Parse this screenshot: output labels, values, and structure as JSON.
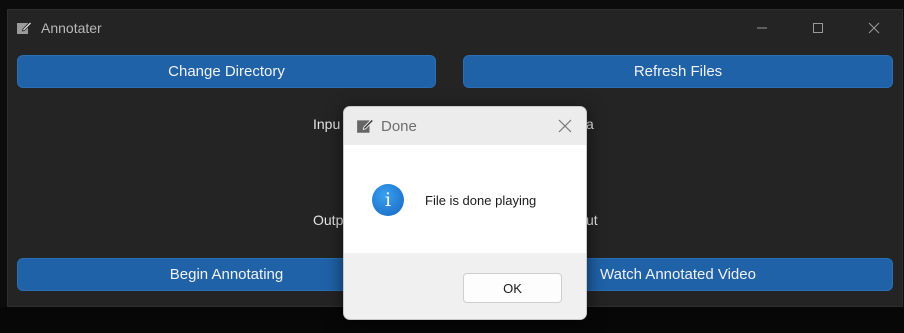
{
  "app": {
    "title": "Annotater",
    "change_directory": "Change Directory",
    "refresh_files": "Refresh Files",
    "input_label": "Inpu",
    "input_label_right": "a",
    "output_label": "Outp",
    "output_label_right": "ut",
    "begin_annotating": "Begin Annotating",
    "watch_annotated_video": "Watch Annotated Video"
  },
  "dialog": {
    "title": "Done",
    "message": "File is done playing",
    "ok_label": "OK",
    "icon": "info-icon"
  },
  "colors": {
    "accent_button": "#1f62a8",
    "window_bg": "#242424"
  }
}
